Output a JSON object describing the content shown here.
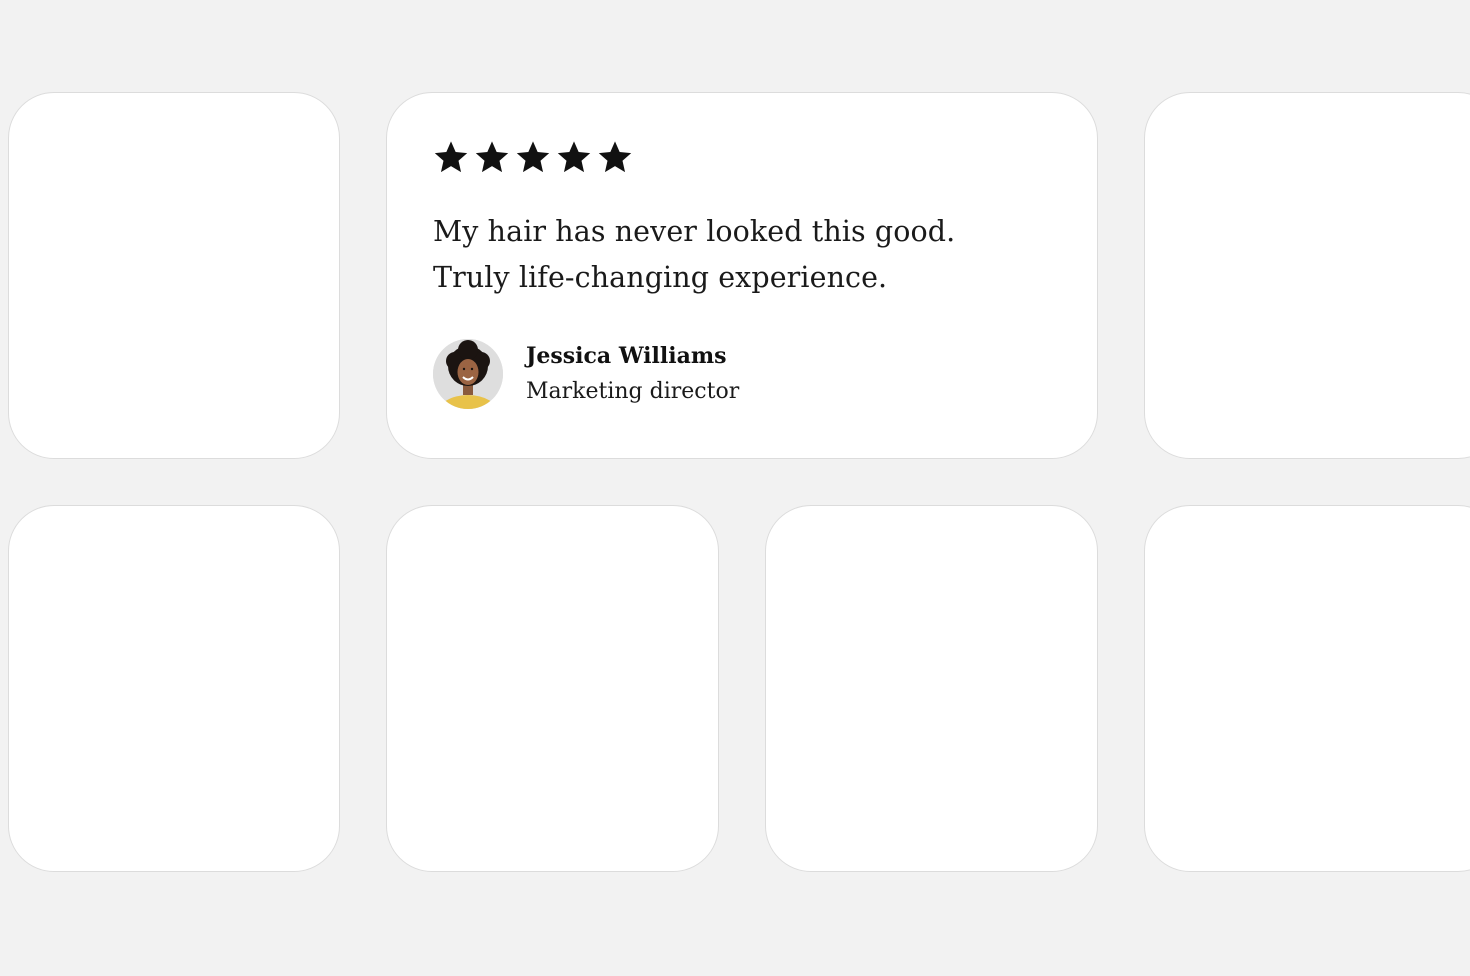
{
  "testimonial": {
    "rating": 5,
    "quote": "My hair has never looked this good. Truly life-changing experience.",
    "author_name": "Jessica Williams",
    "author_role": "Marketing director"
  },
  "icons": {
    "star": "star-icon",
    "avatar": "avatar"
  },
  "colors": {
    "background": "#f2f2f2",
    "card": "#ffffff",
    "card_border": "#dcdcdc",
    "text": "#1a1a1a",
    "star": "#111111",
    "avatar_shirt": "#e8c24a"
  }
}
